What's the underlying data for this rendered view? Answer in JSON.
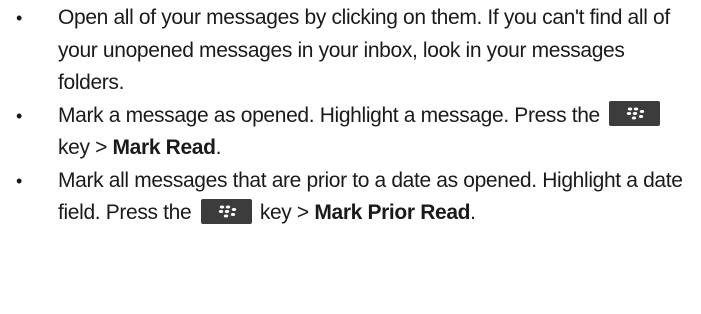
{
  "bullets": [
    {
      "text": "Open all of your messages by clicking on them. If you can't find all of your unopened messages in your inbox, look in your messages folders."
    },
    {
      "pre": "Mark a message as opened. Highlight a message. Press the",
      "key_icon": "blackberry-menu-key-icon",
      "mid": "key >",
      "bold": "Mark Read",
      "post": "."
    },
    {
      "pre": "Mark all messages that are prior to a date as opened. Highlight a date field. Press the",
      "key_icon": "blackberry-menu-key-icon",
      "mid": "key >",
      "bold": "Mark Prior Read",
      "post": "."
    }
  ],
  "bullet_glyph": "•",
  "colors": {
    "text": "#1a1a1a",
    "key_bg": "#3c3c3c",
    "key_dots": "#ffffff"
  }
}
